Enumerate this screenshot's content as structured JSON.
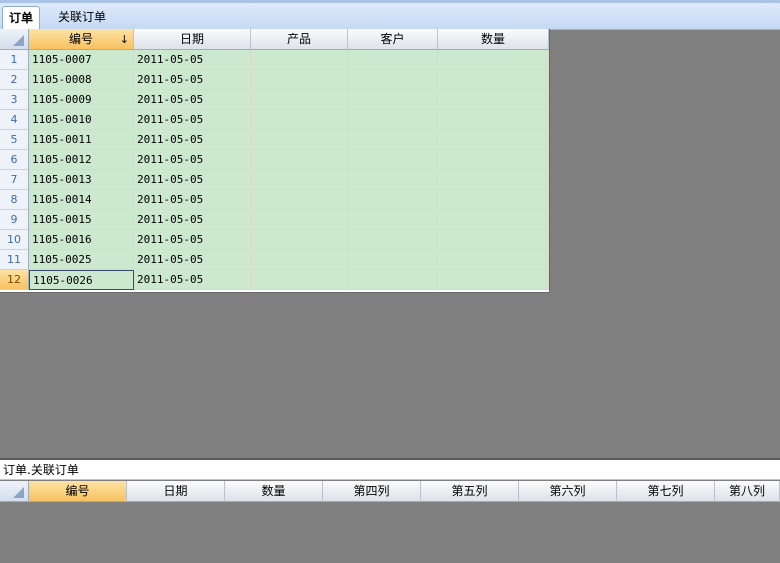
{
  "tabs": [
    {
      "label": "订单",
      "active": true
    },
    {
      "label": "关联订单",
      "active": false
    }
  ],
  "main_grid": {
    "columns": [
      "编号",
      "日期",
      "产品",
      "客户",
      "数量"
    ],
    "sort_indicator": "↓",
    "rows": [
      {
        "num": "1",
        "id": "1105-0007",
        "date": "2011-05-05"
      },
      {
        "num": "2",
        "id": "1105-0008",
        "date": "2011-05-05"
      },
      {
        "num": "3",
        "id": "1105-0009",
        "date": "2011-05-05"
      },
      {
        "num": "4",
        "id": "1105-0010",
        "date": "2011-05-05"
      },
      {
        "num": "5",
        "id": "1105-0011",
        "date": "2011-05-05"
      },
      {
        "num": "6",
        "id": "1105-0012",
        "date": "2011-05-05"
      },
      {
        "num": "7",
        "id": "1105-0013",
        "date": "2011-05-05"
      },
      {
        "num": "8",
        "id": "1105-0014",
        "date": "2011-05-05"
      },
      {
        "num": "9",
        "id": "1105-0015",
        "date": "2011-05-05"
      },
      {
        "num": "10",
        "id": "1105-0016",
        "date": "2011-05-05"
      },
      {
        "num": "11",
        "id": "1105-0025",
        "date": "2011-05-05"
      },
      {
        "num": "12",
        "id": "1105-0026",
        "date": "2011-05-05"
      }
    ],
    "selected_row": 12
  },
  "detail_panel": {
    "title": "订单.关联订单",
    "columns": [
      "编号",
      "日期",
      "数量",
      "第四列",
      "第五列",
      "第六列",
      "第七列",
      "第八列"
    ]
  },
  "colors": {
    "grid_row_bg": "#cce8cf",
    "selected_header": "#f7c15f",
    "background": "#808080"
  }
}
